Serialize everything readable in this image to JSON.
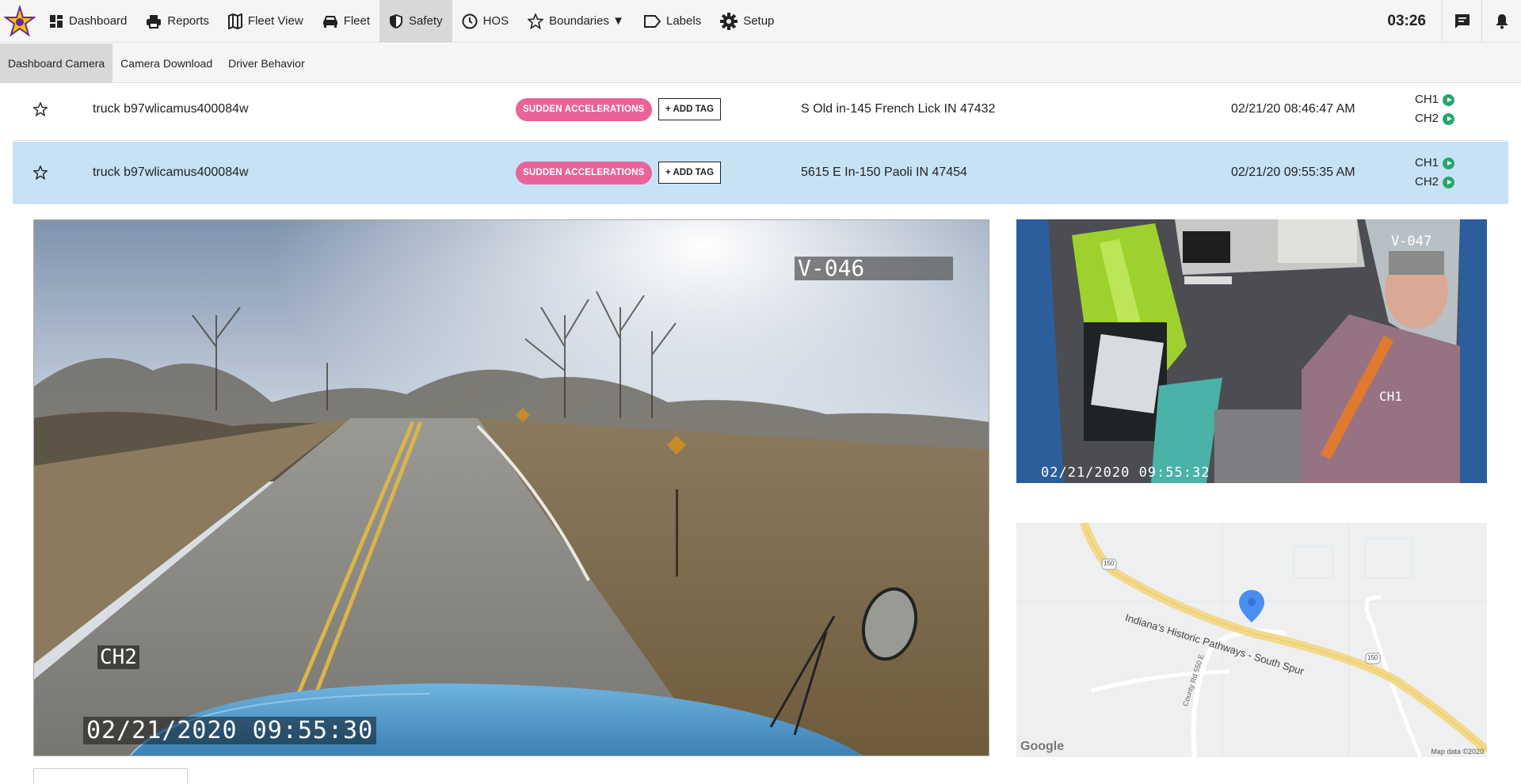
{
  "nav": {
    "items": [
      {
        "label": "Dashboard",
        "icon": "dashboard-icon"
      },
      {
        "label": "Reports",
        "icon": "printer-icon"
      },
      {
        "label": "Fleet View",
        "icon": "map-icon"
      },
      {
        "label": "Fleet",
        "icon": "car-icon"
      },
      {
        "label": "Safety",
        "icon": "shield-icon",
        "active": true
      },
      {
        "label": "HOS",
        "icon": "clock-icon"
      },
      {
        "label": "Boundaries ▼",
        "icon": "star-icon"
      },
      {
        "label": "Labels",
        "icon": "label-icon"
      },
      {
        "label": "Setup",
        "icon": "gear-icon"
      }
    ],
    "clock": "03:26"
  },
  "subnav": {
    "items": [
      {
        "label": "Dashboard Camera",
        "active": true
      },
      {
        "label": "Camera Download"
      },
      {
        "label": "Driver Behavior"
      }
    ]
  },
  "events": [
    {
      "truck": "truck b97wlicamus400084w",
      "tag": "SUDDEN ACCELERATIONS",
      "add_tag": "+ ADD TAG",
      "address": "S Old in-145 French Lick IN 47432",
      "datetime": "02/21/20 08:46:47 AM",
      "ch1": "CH1",
      "ch2": "CH2",
      "selected": false
    },
    {
      "truck": "truck b97wlicamus400084w",
      "tag": "SUDDEN ACCELERATIONS",
      "add_tag": "+ ADD TAG",
      "address": "5615 E In-150 Paoli IN 47454",
      "datetime": "02/21/20 09:55:35 AM",
      "ch1": "CH1",
      "ch2": "CH2",
      "selected": true
    }
  ],
  "video_main": {
    "unit_id": "V-046",
    "channel": "CH2",
    "timestamp": "02/21/2020 09:55:30"
  },
  "video_cab": {
    "unit_id": "V-047",
    "channel": "CH1",
    "timestamp": "02/21/2020 09:55:32"
  },
  "map": {
    "road_label": "Indiana's Historic Pathways - South Spur",
    "route_shield_1": "150",
    "route_shield_2": "150",
    "side_road": "County Rd 550 E",
    "attribution": "Map data ©2020",
    "logo": "Google"
  },
  "colors": {
    "tag_pink": "#e96398",
    "selected_row": "#c7e2f5",
    "play_green": "#2aa56b",
    "map_pin": "#4a8ef0",
    "route_yellow": "#f3d98a"
  }
}
